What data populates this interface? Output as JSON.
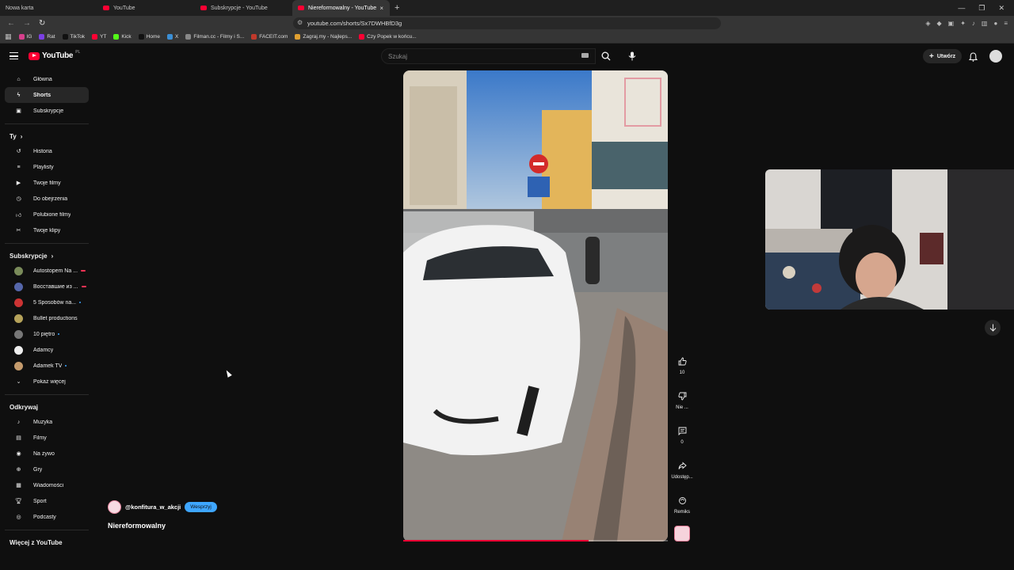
{
  "browser": {
    "tabs": [
      {
        "label": "Nowa karta",
        "active": false,
        "yt": false
      },
      {
        "label": "YouTube",
        "active": false,
        "yt": true
      },
      {
        "label": "Subskrypcje - YouTube",
        "active": false,
        "yt": true
      },
      {
        "label": "Niereformowalny - YouTube",
        "active": true,
        "yt": true
      }
    ],
    "new_tab_label": "+",
    "url": "youtube.com/shorts/Sx7DWHBfD3g",
    "bookmarks": [
      "IG",
      "Rat",
      "TikTok",
      "YT",
      "Kick",
      "Home",
      "X",
      "Filman.cc - Filmy i S...",
      "FACEIT.com",
      "Zagraj.my - Najleps...",
      "Czy Popek w końcu..."
    ]
  },
  "header": {
    "logo_text": "YouTube",
    "logo_region": "PL",
    "search_placeholder": "Szukaj",
    "create_label": "Utwórz"
  },
  "sidebar": {
    "main": [
      {
        "label": "Główna",
        "icon": "home-icon",
        "active": false
      },
      {
        "label": "Shorts",
        "icon": "shorts-icon",
        "active": true
      },
      {
        "label": "Subskrypcje",
        "icon": "subscriptions-icon",
        "active": false
      }
    ],
    "you_title": "Ty",
    "you": [
      {
        "label": "Historia",
        "icon": "history-icon"
      },
      {
        "label": "Playlisty",
        "icon": "playlist-icon"
      },
      {
        "label": "Twoje filmy",
        "icon": "your-videos-icon"
      },
      {
        "label": "Do obejrzenia",
        "icon": "watch-later-icon"
      },
      {
        "label": "Polubione filmy",
        "icon": "liked-icon"
      },
      {
        "label": "Twoje klipy",
        "icon": "clips-icon"
      }
    ],
    "subs_title": "Subskrypcje",
    "subs": [
      {
        "label": "Autostopem Na ...",
        "color": "#7a8b5a",
        "badge": "live"
      },
      {
        "label": "Восставшие из ...",
        "color": "#5566aa",
        "badge": "live"
      },
      {
        "label": "5 Sposobów na...",
        "color": "#cc3333",
        "badge": "dot"
      },
      {
        "label": "Bullet productions",
        "color": "#b5a25a",
        "badge": ""
      },
      {
        "label": "10 piętro",
        "color": "#777777",
        "badge": "dot"
      },
      {
        "label": "Adamcy",
        "color": "#eeeeee",
        "badge": ""
      },
      {
        "label": "Adamek TV",
        "color": "#c49a6c",
        "badge": "dot"
      }
    ],
    "show_more": "Pokaż więcej",
    "explore_title": "Odkrywaj",
    "explore": [
      {
        "label": "Muzyka",
        "icon": "music-icon"
      },
      {
        "label": "Filmy",
        "icon": "film-icon"
      },
      {
        "label": "Na żywo",
        "icon": "live-icon"
      },
      {
        "label": "Gry",
        "icon": "gaming-icon"
      },
      {
        "label": "Wiadomości",
        "icon": "news-icon"
      },
      {
        "label": "Sport",
        "icon": "sport-icon"
      },
      {
        "label": "Podcasty",
        "icon": "podcast-icon"
      }
    ],
    "more_title": "Więcej z YouTube"
  },
  "short": {
    "channel": "@konfitura_w_akcji",
    "support_label": "Wesprzyj",
    "title": "Niereformowalny",
    "progress": 0.7,
    "actions": {
      "like": "10",
      "dislike": "Nie ...",
      "comments": "0",
      "share": "Udostęp...",
      "remix": "Remiks"
    }
  }
}
